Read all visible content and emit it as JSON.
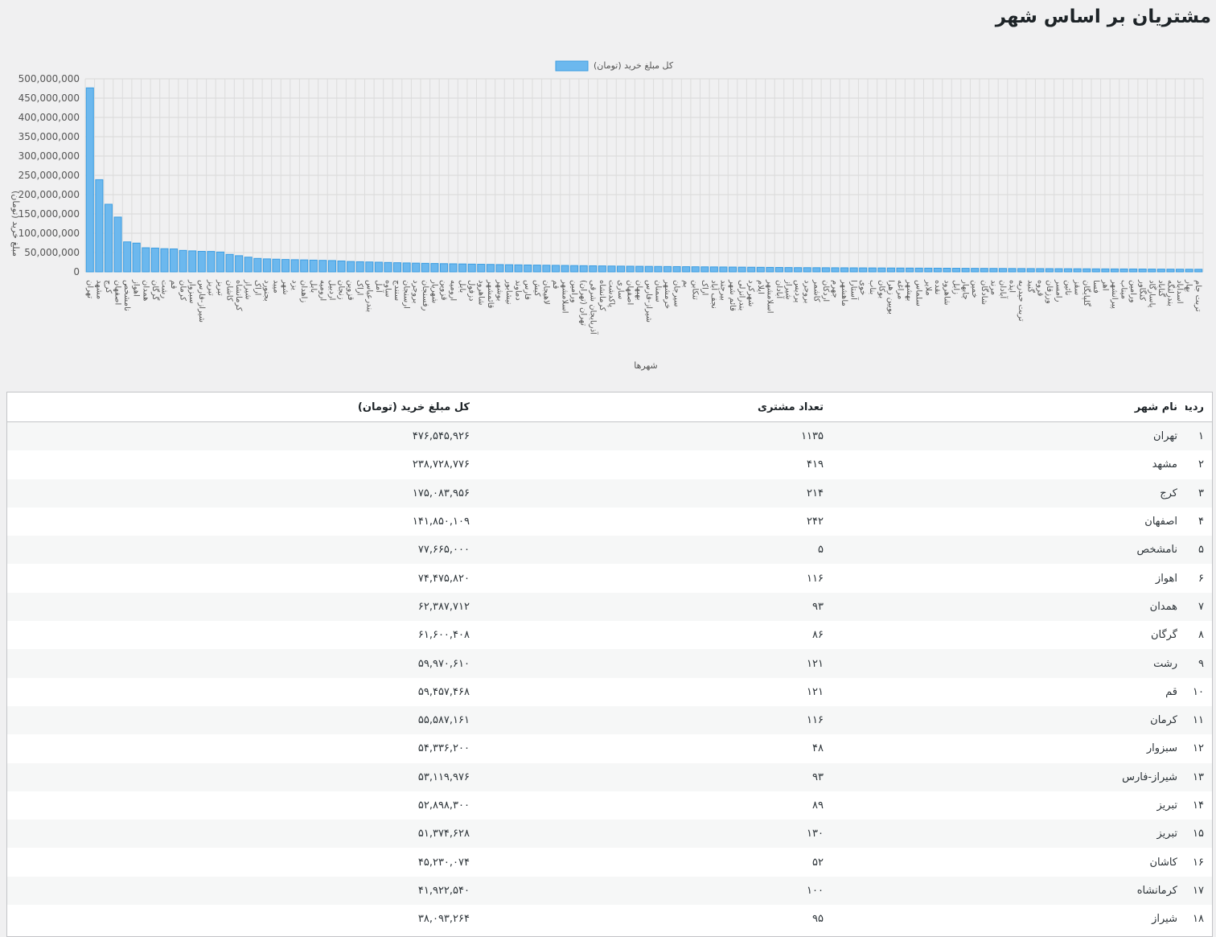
{
  "page": {
    "title": "مشتریان بر اساس شهر"
  },
  "chart_data": {
    "type": "bar",
    "series": [
      {
        "name": "کل مبلغ خرید (تومان)",
        "color": "#6cb8ee",
        "border_color": "#3d9ee2"
      }
    ],
    "ylabel": "مبلغ خرید (تومان)",
    "xlabel": "شهرها",
    "ylim": [
      0,
      500000000
    ],
    "yticks": [
      "0",
      "50,000,000",
      "100,000,000",
      "150,000,000",
      "200,000,000",
      "250,000,000",
      "300,000,000",
      "350,000,000",
      "400,000,000",
      "450,000,000",
      "500,000,000"
    ],
    "grid": true,
    "legend": "top-center",
    "categories": [
      "تهران",
      "مشهد",
      "کرج",
      "اصفهان",
      "نامشخص",
      "اهواز",
      "همدان",
      "گرگان",
      "رشت",
      "قم",
      "کرمان",
      "سبزوار",
      "شیراز-فارس",
      "تبریز",
      "تبریز",
      "کاشان",
      "کرمانشاه",
      "شیراز",
      "اراک",
      "بجنورد",
      "میبد",
      "شهر",
      "یزد",
      "زاهدان",
      "بابل",
      "ارومیه",
      "اردبیل",
      "زنجان",
      "قزوین",
      "اراک",
      "بندرعباس",
      "آمل",
      "ساوه",
      "سنندج",
      "ارسنجان",
      "بروجرد",
      "رفسنجان",
      "شهریار",
      "قزوین",
      "ارومیه",
      "بابل",
      "دزفول",
      "شاهرود",
      "قائمشهر",
      "بوشهر",
      "نیشابور",
      "دماوند",
      "فارس",
      "کیش",
      "لاهیجان",
      "قم",
      "اسلامشهر",
      "ورامین",
      "تهران (تهران)",
      "آذربایجان شرقی",
      "کرمانشاه",
      "پاکدشت",
      "ساری",
      "اصفهان",
      "بهبهان",
      "شیراز-فارس",
      "سمنان",
      "خرمشهر",
      "سیرجان",
      "بم",
      "تنکابن",
      "اراک",
      "نجف آباد",
      "بیرجند",
      "قائم شهر",
      "بندرانزلی",
      "شهرکرد",
      "ایلام",
      "اسلامشهر",
      "آبادان",
      "شیراز",
      "پردیس",
      "بروجرد",
      "کاشمر",
      "اردکان",
      "جهرم",
      "ماهشهر",
      "آستارا",
      "خوی",
      "بناب",
      "بوکان",
      "بویین زهرا",
      "مراغه",
      "بهشهر",
      "سلماس",
      "ملایر",
      "نقده",
      "شاهرود",
      "زابل",
      "چابهار",
      "خمین",
      "شادگان",
      "مرند",
      "آبادان",
      "ایذه",
      "تربت حیدریه",
      "گنبد",
      "قروه",
      "ورزقان",
      "رامسر",
      "نائین",
      "سقز",
      "گلپایگان",
      "فسا",
      "اهر",
      "پیرانشهر",
      "میناب",
      "ورامین",
      "کنگاور",
      "پاسارگاد",
      "گناباد",
      "بندرلنگه",
      "اسدآباد",
      "بهار",
      "تربت جام"
    ],
    "values": [
      476545926,
      238728776,
      175083956,
      141850109,
      77665000,
      74475820,
      62387712,
      61600408,
      59970610,
      59457468,
      55587161,
      54336200,
      53119976,
      52898300,
      51374628,
      45230074,
      41922540,
      38093264,
      34800000,
      33600000,
      32800000,
      32100000,
      31500000,
      31000000,
      30400000,
      29800000,
      29300000,
      28200000,
      26800000,
      26200000,
      25600000,
      25000000,
      24300000,
      23700000,
      23100000,
      22600000,
      22100000,
      21700000,
      21300000,
      20900000,
      20500000,
      20100000,
      19700000,
      19300000,
      18900000,
      18500000,
      18100000,
      17800000,
      17500000,
      17200000,
      16900000,
      16600000,
      16300000,
      16000000,
      15700000,
      15400000,
      15100000,
      14800000,
      14600000,
      14400000,
      14200000,
      14000000,
      13800000,
      13600000,
      13400000,
      13200000,
      13000000,
      12800000,
      12600000,
      12400000,
      12200000,
      12000000,
      11800000,
      11600000,
      11400000,
      11200000,
      11000000,
      10900000,
      10800000,
      10700000,
      10600000,
      10500000,
      10400000,
      10300000,
      10200000,
      10100000,
      10000000,
      9900000,
      9800000,
      9700000,
      9600000,
      9500000,
      9400000,
      9300000,
      9200000,
      9100000,
      9000000,
      8900000,
      8800000,
      8700000,
      8600000,
      8500000,
      8400000,
      8300000,
      8200000,
      8100000,
      8000000,
      7900000,
      7800000,
      7700000,
      7600000,
      7500000,
      7400000,
      7300000,
      7200000,
      7100000,
      7000000,
      6900000,
      6800000,
      6700000
    ]
  },
  "table": {
    "headers": {
      "row": "ردیف",
      "city": "نام شهر",
      "count": "تعداد مشتری",
      "total": "کل مبلغ خرید (تومان)"
    },
    "rows": [
      {
        "row": "۱",
        "city": "تهران",
        "count": "۱۱۳۵",
        "total": "۴۷۶,۵۴۵,۹۲۶"
      },
      {
        "row": "۲",
        "city": "مشهد",
        "count": "۴۱۹",
        "total": "۲۳۸,۷۲۸,۷۷۶"
      },
      {
        "row": "۳",
        "city": "کرج",
        "count": "۲۱۴",
        "total": "۱۷۵,۰۸۳,۹۵۶"
      },
      {
        "row": "۴",
        "city": "اصفهان",
        "count": "۲۴۲",
        "total": "۱۴۱,۸۵۰,۱۰۹"
      },
      {
        "row": "۵",
        "city": "نامشخص",
        "count": "۵",
        "total": "۷۷,۶۶۵,۰۰۰"
      },
      {
        "row": "۶",
        "city": "اهواز",
        "count": "۱۱۶",
        "total": "۷۴,۴۷۵,۸۲۰"
      },
      {
        "row": "۷",
        "city": "همدان",
        "count": "۹۳",
        "total": "۶۲,۳۸۷,۷۱۲"
      },
      {
        "row": "۸",
        "city": "گرگان",
        "count": "۸۶",
        "total": "۶۱,۶۰۰,۴۰۸"
      },
      {
        "row": "۹",
        "city": "رشت",
        "count": "۱۲۱",
        "total": "۵۹,۹۷۰,۶۱۰"
      },
      {
        "row": "۱۰",
        "city": "قم",
        "count": "۱۲۱",
        "total": "۵۹,۴۵۷,۴۶۸"
      },
      {
        "row": "۱۱",
        "city": "کرمان",
        "count": "۱۱۶",
        "total": "۵۵,۵۸۷,۱۶۱"
      },
      {
        "row": "۱۲",
        "city": "سبزوار",
        "count": "۴۸",
        "total": "۵۴,۳۳۶,۲۰۰"
      },
      {
        "row": "۱۳",
        "city": "شیراز-فارس",
        "count": "۹۳",
        "total": "۵۳,۱۱۹,۹۷۶"
      },
      {
        "row": "۱۴",
        "city": "تبریز",
        "count": "۸۹",
        "total": "۵۲,۸۹۸,۳۰۰"
      },
      {
        "row": "۱۵",
        "city": "تبریز",
        "count": "۱۳۰",
        "total": "۵۱,۳۷۴,۶۲۸"
      },
      {
        "row": "۱۶",
        "city": "کاشان",
        "count": "۵۲",
        "total": "۴۵,۲۳۰,۰۷۴"
      },
      {
        "row": "۱۷",
        "city": "کرمانشاه",
        "count": "۱۰۰",
        "total": "۴۱,۹۲۲,۵۴۰"
      },
      {
        "row": "۱۸",
        "city": "شیراز",
        "count": "۹۵",
        "total": "۳۸,۰۹۳,۲۶۴"
      }
    ]
  }
}
